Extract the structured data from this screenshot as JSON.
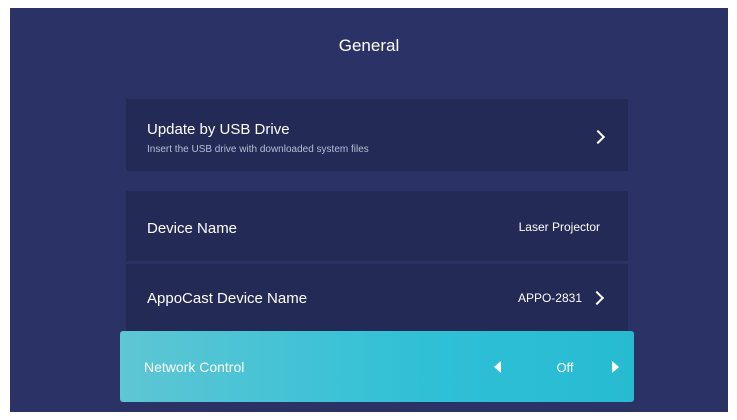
{
  "page": {
    "title": "General"
  },
  "rows": {
    "usb": {
      "label": "Update by USB Drive",
      "description": "Insert the USB drive with downloaded system files",
      "icon": "chevron-right-icon"
    },
    "device_name": {
      "label": "Device Name",
      "value": "Laser Projector"
    },
    "appocast": {
      "label": "AppoCast Device Name",
      "value": "APPO-2831",
      "icon": "chevron-right-icon"
    },
    "network_control": {
      "label": "Network Control",
      "value": "Off",
      "selected": true,
      "icons": [
        "triangle-left-icon",
        "triangle-right-icon"
      ]
    }
  },
  "colors": {
    "background": "#2b3366",
    "row": "#222a55",
    "highlight": "#2fc0d6"
  }
}
